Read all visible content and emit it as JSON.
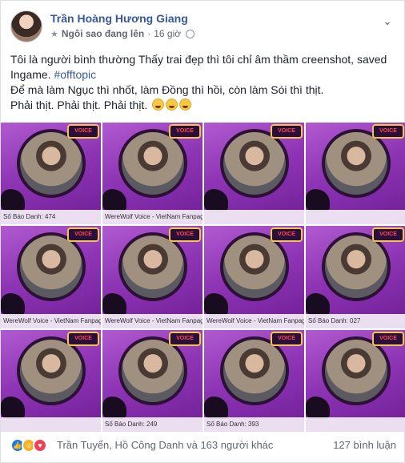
{
  "post": {
    "author": "Trần Hoàng Hương Giang",
    "badge": "Ngôi sao đang lên",
    "time": "16 giờ",
    "line1": "Tôi là người bình thường Thấy trai đẹp thì tôi chỉ âm thầm creenshot, saved Ingame. ",
    "hashtag": "#offtopic",
    "line2": "Để mà làm Ngục thì nhốt, làm Đồng thì hồi, còn làm Sói thì thịt.",
    "line3": "Phải thịt. Phải thịt. Phải thịt."
  },
  "cards": [
    {
      "caption": "Số Báo Danh: 474"
    },
    {
      "caption": "WereWolf Voice - VietNam Fanpage"
    },
    {
      "caption": ""
    },
    {
      "caption": ""
    },
    {
      "caption": "WereWolf Voice - VietNam Fanpage"
    },
    {
      "caption": "WereWolf Voice - VietNam Fanpage"
    },
    {
      "caption": "WereWolf Voice - VietNam Fanpage"
    },
    {
      "caption": "Số Báo Danh: 027"
    },
    {
      "caption": ""
    },
    {
      "caption": "Số Báo Danh: 249"
    },
    {
      "caption": "Số Báo Danh: 393"
    },
    {
      "caption": ""
    }
  ],
  "footer": {
    "reaction_names": "Trần Tuyển, Hồ Công Danh và 163 người khác",
    "comments": "127 bình luận"
  },
  "icons": {
    "like": "like-icon",
    "haha": "haha-icon",
    "love": "love-icon",
    "chevron": "chevron-down-icon"
  },
  "colors": {
    "link": "#385898",
    "card_purple": "#8e35b5",
    "like_blue": "#1877f2"
  }
}
